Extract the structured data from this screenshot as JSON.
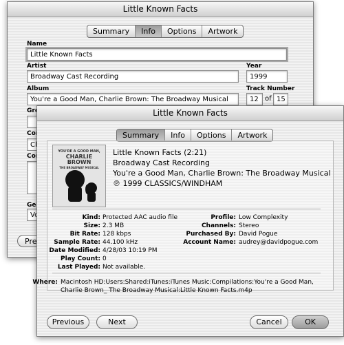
{
  "back_window": {
    "title": "Little Known Facts",
    "tabs": [
      "Summary",
      "Info",
      "Options",
      "Artwork"
    ],
    "active_tab": "Info",
    "name_label": "Name",
    "name_value": "Little Known Facts",
    "artist_label": "Artist",
    "artist_value": "Broadway Cast Recording",
    "year_label": "Year",
    "year_value": "1999",
    "album_label": "Album",
    "album_value": "You're a Good Man, Charlie Brown: The Broadway Musical",
    "track_label": "Track Number",
    "track_value": "12",
    "track_of": "of",
    "track_total": "15",
    "grouping_label_partial": "Gro",
    "composer_label_partial": "Com",
    "composer_value_partial": "Cla",
    "comments_label_partial": "Com",
    "genre_label_partial": "Gen",
    "genre_value_partial": "Voc",
    "previous_partial": "Prev"
  },
  "front_window": {
    "title": "Little Known Facts",
    "tabs": [
      "Summary",
      "Info",
      "Options",
      "Artwork"
    ],
    "active_tab": "Summary",
    "artwork": {
      "line1": "YOU'RE A GOOD MAN,",
      "line2": "CHARLIE",
      "line3": "BROWN",
      "line4": "THE BROADWAY MUSICAL"
    },
    "summary": {
      "title_line": "Little Known Facts (2:21)",
      "artist": "Broadway Cast Recording",
      "album": "You're a Good Man, Charlie Brown: The Broadway Musical",
      "copyright": "℗ 1999 CLASSICS/WINDHAM"
    },
    "details_left": [
      {
        "key": "Kind:",
        "value": "Protected AAC audio file"
      },
      {
        "key": "Size:",
        "value": "2.3 MB"
      },
      {
        "key": "Bit Rate:",
        "value": "128 kbps"
      },
      {
        "key": "Sample Rate:",
        "value": "44.100 kHz"
      },
      {
        "key": "Date Modified:",
        "value": "4/28/03 10:19 PM"
      },
      {
        "key": "Play Count:",
        "value": "0"
      },
      {
        "key": "Last Played:",
        "value": "Not available."
      }
    ],
    "details_right": [
      {
        "key": "Profile:",
        "value": "Low Complexity"
      },
      {
        "key": "Channels:",
        "value": "Stereo"
      },
      {
        "key": "Purchased By:",
        "value": "David Pogue"
      },
      {
        "key": "Account Name:",
        "value": "audrey@davidpogue.com"
      }
    ],
    "where_label": "Where:",
    "where_line1": "Macintosh HD:Users:Shared:iTunes:iTunes Music:Compilations:You're a Good Man,",
    "where_line2": "Charlie Brown_ The Broadway Musical:Little Known Facts.m4p",
    "buttons": {
      "previous": "Previous",
      "next": "Next",
      "cancel": "Cancel",
      "ok": "OK"
    }
  }
}
